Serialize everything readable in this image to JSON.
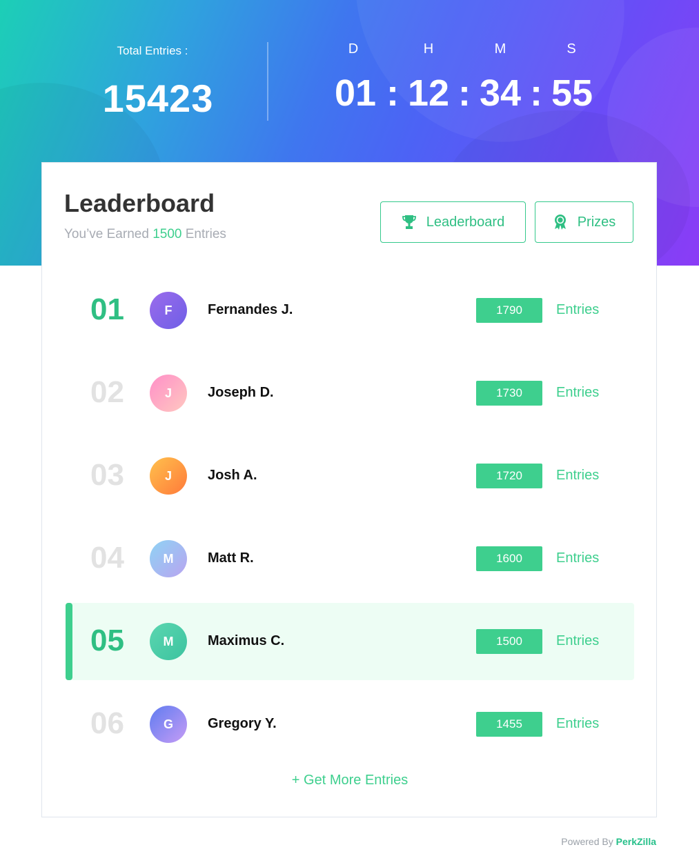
{
  "hero": {
    "total_label": "Total Entries :",
    "total_value": "15423",
    "countdown": {
      "units": [
        "D",
        "H",
        "M",
        "S"
      ],
      "values": [
        "01",
        "12",
        "34",
        "55"
      ],
      "separator": ":"
    }
  },
  "card": {
    "title": "Leaderboard",
    "subtitle_prefix": "You’ve Earned",
    "subtitle_value": "1500",
    "subtitle_suffix": "Entries",
    "tabs": [
      {
        "label": "Leaderboard",
        "icon": "trophy-icon"
      },
      {
        "label": "Prizes",
        "icon": "award-ribbon-icon"
      }
    ],
    "rows": [
      {
        "rank": "01",
        "initial": "F",
        "name": "Fernandes J.",
        "entries": "1790",
        "entries_label": "Entries"
      },
      {
        "rank": "02",
        "initial": "J",
        "name": "Joseph D.",
        "entries": "1730",
        "entries_label": "Entries"
      },
      {
        "rank": "03",
        "initial": "J",
        "name": "Josh A.",
        "entries": "1720",
        "entries_label": "Entries"
      },
      {
        "rank": "04",
        "initial": "M",
        "name": "Matt R.",
        "entries": "1600",
        "entries_label": "Entries"
      },
      {
        "rank": "05",
        "initial": "M",
        "name": "Maximus C.",
        "entries": "1500",
        "entries_label": "Entries"
      },
      {
        "rank": "06",
        "initial": "G",
        "name": "Gregory Y.",
        "entries": "1455",
        "entries_label": "Entries"
      }
    ],
    "get_more": "+ Get More Entries"
  },
  "footer": {
    "powered_prefix": "Powered By",
    "brand": "PerkZilla"
  },
  "colors": {
    "accent": "#3ecf8e",
    "rank_top": "#2fbf83",
    "rank_muted": "#e2e2e2",
    "highlight_row": "#edfdf4"
  }
}
